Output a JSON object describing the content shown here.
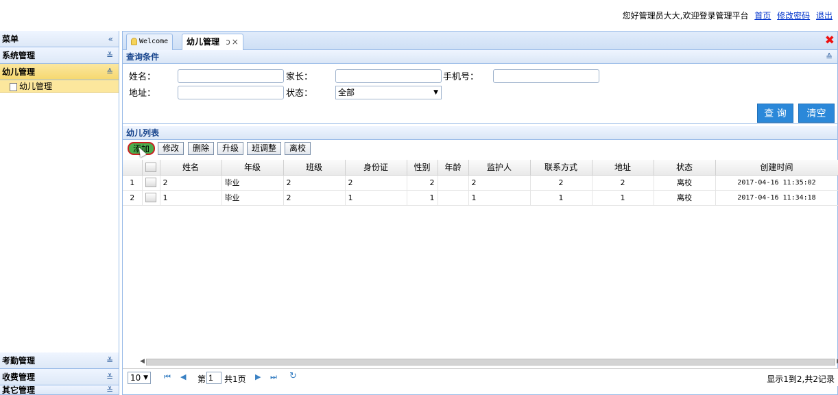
{
  "header": {
    "welcome": "您好管理员大大,欢迎登录管理平台",
    "links": [
      "首页",
      "修改密码",
      "退出"
    ]
  },
  "sidebar": {
    "title": "菜单",
    "collapse_icon": "«",
    "groups": [
      {
        "label": "系统管理",
        "icon": "double-chevron-down"
      },
      {
        "label": "幼儿管理",
        "icon": "double-chevron-up",
        "active": true,
        "items": [
          "幼儿管理"
        ]
      }
    ],
    "bottom_groups": [
      "考勤管理",
      "收费管理",
      "其它管理"
    ],
    "chevron_down": "≚",
    "chevron_up": "≙"
  },
  "tabs": [
    {
      "label": "Welcome",
      "icon": "lightbulb"
    },
    {
      "label": "幼儿管理",
      "refresh": "ↄ",
      "close": "×"
    }
  ],
  "close_all_icon": "✖",
  "query": {
    "title": "查询条件",
    "name_label": "姓名：",
    "parent_label": "家长：",
    "phone_label": "手机号：",
    "address_label": "地址：",
    "status_label": "状态：",
    "status_value": "全部",
    "search_button": "查 询",
    "clear_button": "清空",
    "collapse_icon": "≙"
  },
  "list": {
    "title": "幼儿列表",
    "toolbar": [
      "添加",
      "修改",
      "删除",
      "升级",
      "班调整",
      "离校"
    ],
    "columns": [
      "",
      "",
      "姓名",
      "年级",
      "班级",
      "身份证",
      "性别",
      "年龄",
      "监护人",
      "联系方式",
      "地址",
      "状态",
      "创建时间"
    ],
    "rows": [
      {
        "no": "1",
        "name": "2",
        "grade": "毕业",
        "class": "2",
        "id_card": "2",
        "gender": "2",
        "age": "",
        "guardian": "2",
        "contact": "2",
        "address": "2",
        "status": "离校",
        "created": "2017-04-16 11:35:02"
      },
      {
        "no": "2",
        "name": "1",
        "grade": "毕业",
        "class": "2",
        "id_card": "1",
        "gender": "1",
        "age": "",
        "guardian": "1",
        "contact": "1",
        "address": "1",
        "status": "离校",
        "created": "2017-04-16 11:34:18"
      }
    ]
  },
  "pager": {
    "page_size": "10",
    "page_prefix": "第",
    "page_value": "1",
    "page_total": "共1页",
    "info": "显示1到2,共2记录",
    "first": "⏮",
    "prev": "◀",
    "next": "▶",
    "last": "⏭",
    "refresh": "↻"
  },
  "colors": {
    "accent": "#2b88d9",
    "active_menu": "#f6d86f",
    "border": "#99bbe8"
  }
}
